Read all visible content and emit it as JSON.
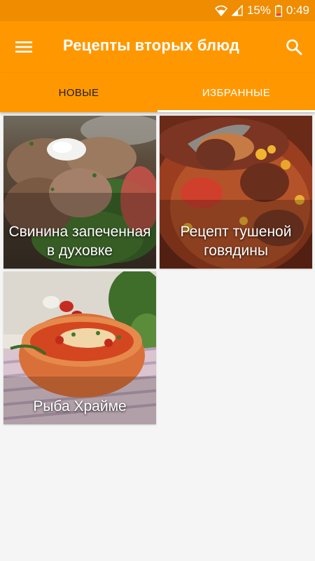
{
  "status_bar": {
    "battery_percent": "15%",
    "time": "0:49",
    "icons": [
      "wifi-icon",
      "signal-icon",
      "battery-icon"
    ]
  },
  "app_bar": {
    "title": "Рецепты вторых блюд",
    "menu_icon": "hamburger-menu-icon",
    "search_icon": "search-icon"
  },
  "tabs": [
    {
      "label": "НОВЫЕ",
      "selected": false
    },
    {
      "label": "ИЗБРАННЫЕ",
      "selected": true
    }
  ],
  "recipes": [
    {
      "title": "Свинина запеченная в духовке"
    },
    {
      "title": "Рецепт тушеной говядины"
    },
    {
      "title": "Рыба Храйме"
    }
  ],
  "colors": {
    "primary": "#ff9800",
    "status_bar": "#f08c00",
    "background": "#f5f5f5"
  }
}
